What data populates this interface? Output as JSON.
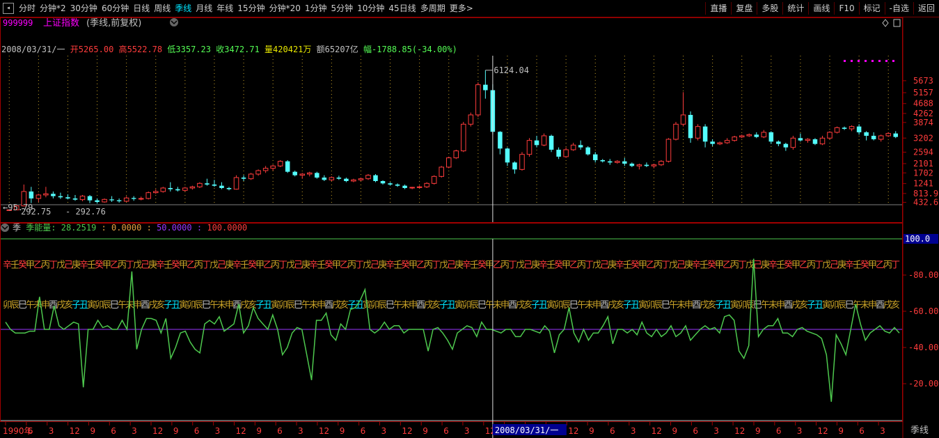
{
  "toolbar": {
    "left_items": [
      "分时",
      "分钟*2",
      "30分钟",
      "60分钟",
      "日线",
      "周线",
      "季线",
      "月线",
      "年线",
      "15分钟",
      "分钟*20",
      "1分钟",
      "5分钟",
      "10分钟",
      "45日线",
      "多周期",
      "更多>"
    ],
    "active_item": "季线",
    "right_items": [
      "直播",
      "复盘",
      "多股",
      "统计",
      "画线",
      "F10",
      "标记",
      "-自选",
      "返回"
    ]
  },
  "header": {
    "code": "999999",
    "name": "上证指数",
    "mode": "(季线,前复权)",
    "dropdown_icon": "chevron-down-icon",
    "right_icons": [
      "diamond-icon",
      "box-icon"
    ]
  },
  "ohlc_line": {
    "date": "2008/03/31/一",
    "open_label": "开",
    "open": "5265.00",
    "high_label": "高",
    "high": "5522.78",
    "low_label": "低",
    "low": "3357.23",
    "close_label": "收",
    "close": "3472.71",
    "vol_label": "量",
    "vol": "420421万",
    "amount_label": "额",
    "amount": "65207亿",
    "range_label": "幅",
    "range": "-1788.85(-34.00%)"
  },
  "indicator_header": {
    "prefix": "季",
    "name": "季能量:",
    "v1": "28.2519",
    "sep1": ":",
    "v2": "0.0000",
    "sep2": ":",
    "v3": "50.0000",
    "sep3": ":",
    "v4": "100.0000"
  },
  "colors": {
    "up": "#ff3c3c",
    "down": "#54fcfc",
    "axis": "#b00000",
    "line": "#4ec94e",
    "purple": "#9a36ff",
    "magenta": "#ff00ff",
    "gold": "#c9a227",
    "text": "#c0c0c0",
    "orange": "#e8a040",
    "cyan": "#00e5ff"
  },
  "chart_data": [
    {
      "type": "candlestick",
      "title": "",
      "price_axis_ticks": [
        5673,
        5157,
        4688,
        4262,
        3874,
        3202,
        2594,
        2101,
        1702,
        1241,
        813.9,
        432.6
      ],
      "extreme_high_label": "6124.04",
      "extreme_low_label": "95.79",
      "low_labels": [
        "292.75",
        "292.76"
      ],
      "ylim": [
        0,
        6600
      ],
      "candles": [
        [
          96,
          120,
          96,
          110
        ],
        [
          110,
          300,
          100,
          280
        ],
        [
          280,
          1200,
          260,
          900
        ],
        [
          900,
          1100,
          400,
          600
        ],
        [
          600,
          800,
          450,
          750
        ],
        [
          750,
          1100,
          650,
          800
        ],
        [
          800,
          900,
          600,
          700
        ],
        [
          700,
          850,
          580,
          650
        ],
        [
          650,
          780,
          560,
          600
        ],
        [
          600,
          750,
          500,
          550
        ],
        [
          550,
          750,
          480,
          700
        ],
        [
          700,
          750,
          400,
          520
        ],
        [
          520,
          600,
          380,
          450
        ],
        [
          450,
          600,
          420,
          560
        ],
        [
          560,
          700,
          450,
          520
        ],
        [
          520,
          600,
          420,
          480
        ],
        [
          480,
          700,
          450,
          620
        ],
        [
          620,
          700,
          500,
          580
        ],
        [
          580,
          680,
          520,
          600
        ],
        [
          600,
          900,
          560,
          850
        ],
        [
          850,
          1000,
          800,
          900
        ],
        [
          900,
          1100,
          850,
          1050
        ],
        [
          1050,
          1300,
          900,
          1000
        ],
        [
          1000,
          1100,
          900,
          950
        ],
        [
          950,
          1100,
          900,
          1050
        ],
        [
          1050,
          1150,
          980,
          1100
        ],
        [
          1100,
          1300,
          1050,
          1250
        ],
        [
          1250,
          1450,
          1150,
          1200
        ],
        [
          1200,
          1400,
          1100,
          1150
        ],
        [
          1150,
          1300,
          1000,
          1050
        ],
        [
          1050,
          1100,
          950,
          1000
        ],
        [
          1000,
          1600,
          980,
          1500
        ],
        [
          1500,
          1600,
          1350,
          1450
        ],
        [
          1450,
          1700,
          1400,
          1650
        ],
        [
          1650,
          1850,
          1580,
          1800
        ],
        [
          1800,
          2000,
          1700,
          1900
        ],
        [
          1900,
          2050,
          1800,
          2000
        ],
        [
          2000,
          2250,
          1950,
          2200
        ],
        [
          2200,
          2250,
          1700,
          1750
        ],
        [
          1750,
          1800,
          1550,
          1600
        ],
        [
          1600,
          1700,
          1450,
          1650
        ],
        [
          1650,
          1750,
          1550,
          1700
        ],
        [
          1700,
          1750,
          1450,
          1500
        ],
        [
          1500,
          1600,
          1350,
          1400
        ],
        [
          1400,
          1550,
          1350,
          1500
        ],
        [
          1500,
          1580,
          1400,
          1450
        ],
        [
          1450,
          1500,
          1300,
          1350
        ],
        [
          1350,
          1450,
          1300,
          1400
        ],
        [
          1400,
          1500,
          1350,
          1450
        ],
        [
          1450,
          1650,
          1400,
          1600
        ],
        [
          1600,
          1650,
          1300,
          1350
        ],
        [
          1350,
          1380,
          1200,
          1250
        ],
        [
          1250,
          1300,
          1150,
          1200
        ],
        [
          1200,
          1250,
          1100,
          1150
        ],
        [
          1150,
          1200,
          1000,
          1050
        ],
        [
          1050,
          1100,
          1000,
          1080
        ],
        [
          1080,
          1150,
          1050,
          1100
        ],
        [
          1100,
          1300,
          1050,
          1250
        ],
        [
          1250,
          1600,
          1200,
          1550
        ],
        [
          1550,
          2000,
          1500,
          1950
        ],
        [
          1950,
          2400,
          1900,
          2350
        ],
        [
          2350,
          2700,
          2300,
          2650
        ],
        [
          2650,
          3900,
          2600,
          3800
        ],
        [
          3800,
          4300,
          3700,
          4200
        ],
        [
          4200,
          5600,
          4100,
          5500
        ],
        [
          5500,
          6124,
          4900,
          5265
        ],
        [
          5265,
          5522,
          3357,
          3472
        ],
        [
          3472,
          3500,
          2500,
          2750
        ],
        [
          2750,
          2800,
          2000,
          2150
        ],
        [
          2150,
          2200,
          1664,
          1850
        ],
        [
          1850,
          2600,
          1800,
          2500
        ],
        [
          2500,
          3200,
          2400,
          3100
        ],
        [
          3100,
          3300,
          2800,
          2900
        ],
        [
          2900,
          3400,
          2850,
          3300
        ],
        [
          3300,
          3350,
          2600,
          2700
        ],
        [
          2700,
          2800,
          2300,
          2400
        ],
        [
          2400,
          2800,
          2350,
          2700
        ],
        [
          2700,
          3000,
          2650,
          2900
        ],
        [
          2900,
          3100,
          2700,
          2800
        ],
        [
          2800,
          2850,
          2450,
          2500
        ],
        [
          2500,
          2600,
          2150,
          2250
        ],
        [
          2250,
          2300,
          2150,
          2200
        ],
        [
          2200,
          2300,
          2050,
          2150
        ],
        [
          2150,
          2250,
          2100,
          2200
        ],
        [
          2200,
          2350,
          2000,
          2100
        ],
        [
          2100,
          2150,
          1950,
          2000
        ],
        [
          2000,
          2100,
          1850,
          2050
        ],
        [
          2050,
          2150,
          1950,
          2000
        ],
        [
          2000,
          2100,
          1900,
          2050
        ],
        [
          2050,
          2250,
          2000,
          2200
        ],
        [
          2200,
          3200,
          2150,
          3150
        ],
        [
          3150,
          3900,
          3100,
          3800
        ],
        [
          3800,
          5180,
          3700,
          4200
        ],
        [
          4200,
          4350,
          3000,
          3200
        ],
        [
          3200,
          3800,
          3100,
          3700
        ],
        [
          3700,
          3800,
          2800,
          3050
        ],
        [
          3050,
          3150,
          2850,
          2950
        ],
        [
          2950,
          3050,
          2900,
          3000
        ],
        [
          3000,
          3200,
          2950,
          3100
        ],
        [
          3100,
          3300,
          3050,
          3250
        ],
        [
          3250,
          3350,
          3200,
          3300
        ],
        [
          3300,
          3400,
          3250,
          3350
        ],
        [
          3350,
          3450,
          3200,
          3250
        ],
        [
          3250,
          3550,
          3200,
          3450
        ],
        [
          3450,
          3500,
          2950,
          3050
        ],
        [
          3050,
          3100,
          2850,
          2950
        ],
        [
          2950,
          3000,
          2650,
          2800
        ],
        [
          2800,
          3300,
          2700,
          3200
        ],
        [
          3200,
          3400,
          3050,
          3100
        ],
        [
          3100,
          3200,
          3000,
          3150
        ],
        [
          3150,
          3200,
          2900,
          2950
        ],
        [
          2950,
          3300,
          2900,
          3200
        ],
        [
          3200,
          3500,
          3150,
          3450
        ],
        [
          3450,
          3700,
          3400,
          3650
        ],
        [
          3650,
          3700,
          3550,
          3600
        ],
        [
          3600,
          3750,
          3500,
          3700
        ],
        [
          3700,
          3800,
          3350,
          3450
        ],
        [
          3450,
          3500,
          3100,
          3300
        ],
        [
          3300,
          3450,
          3100,
          3150
        ],
        [
          3150,
          3350,
          3050,
          3300
        ],
        [
          3300,
          3450,
          3250,
          3400
        ],
        [
          3400,
          3500,
          3200,
          3250
        ]
      ],
      "crosshair_index": 66
    },
    {
      "type": "line",
      "title": "季能量",
      "right_axis_ticks": [
        100.0,
        80.0,
        60.0,
        40.0,
        20.0
      ],
      "ylim": [
        0,
        100
      ],
      "reference_lines": [
        50,
        100
      ],
      "series": [
        {
          "name": "季能量",
          "values": [
            54,
            50,
            48,
            48,
            48,
            49,
            49,
            68,
            50,
            50,
            63,
            52,
            50,
            52,
            54,
            53,
            18,
            50,
            50,
            55,
            51,
            52,
            50,
            50,
            55,
            50,
            82,
            39,
            50,
            56,
            56,
            55,
            48,
            56,
            34,
            40,
            48,
            49,
            43,
            39,
            37,
            53,
            55,
            53,
            57,
            49,
            51,
            53,
            64,
            48,
            52,
            62,
            56,
            53,
            50,
            58,
            50,
            36,
            40,
            48,
            51,
            50,
            36,
            22,
            55,
            55,
            59,
            47,
            44,
            53,
            50,
            61,
            62,
            66,
            72,
            50,
            48,
            50,
            54,
            50,
            52,
            52,
            48,
            50,
            50,
            50,
            50,
            38,
            50,
            51,
            48,
            44,
            39,
            48,
            50,
            52,
            51,
            46,
            54,
            50,
            50,
            49,
            48,
            50,
            50,
            46,
            46,
            50,
            50,
            49,
            48,
            52,
            49,
            37,
            47,
            50,
            62,
            48,
            43,
            50,
            44,
            48,
            48,
            52,
            57,
            42,
            50,
            50,
            48,
            50,
            47,
            54,
            48,
            46,
            50,
            46,
            48,
            52,
            46,
            48,
            52,
            44,
            47,
            50,
            52,
            50,
            51,
            48,
            57,
            58,
            55,
            38,
            34,
            41,
            89,
            46,
            50,
            52,
            52,
            56,
            48,
            48,
            46,
            50,
            51,
            49,
            48,
            47,
            45,
            36,
            10,
            47,
            42,
            36,
            50,
            64,
            53,
            44,
            48,
            50,
            52,
            49,
            48,
            51,
            48
          ]
        }
      ],
      "glyph_rows": {
        "upper": "辛壬癸甲乙丙丁戊己庚",
        "lower": "卯辰巳午未申酉戌亥子丑寅"
      }
    }
  ],
  "bottom_axis": {
    "labels": [
      "1990年",
      "6",
      "3",
      "12",
      "9",
      "6",
      "3",
      "12",
      "9",
      "6",
      "3",
      "12",
      "9",
      "6",
      "3",
      "12",
      "9",
      "6",
      "3",
      "12",
      "9",
      "6",
      "3",
      "12",
      "9",
      "6",
      "3",
      "12",
      "9",
      "6",
      "3",
      "12",
      "9",
      "6",
      "3",
      "12",
      "9",
      "6",
      "3",
      "12",
      "9",
      "6",
      "3"
    ],
    "crosshair_date": "2008/03/31/一",
    "period_label": "季线"
  }
}
